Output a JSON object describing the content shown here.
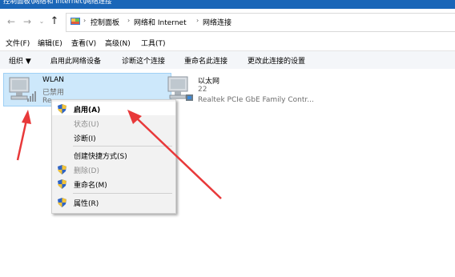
{
  "window": {
    "title": "控制面板\\网络和 Internet\\网络连接"
  },
  "address": {
    "crumbs": [
      "控制面板",
      "网络和 Internet",
      "网络连接"
    ]
  },
  "menu": {
    "items": [
      "文件(F)",
      "编辑(E)",
      "查看(V)",
      "高级(N)",
      "工具(T)"
    ]
  },
  "commands": {
    "items": [
      "组织 ▼",
      "启用此网络设备",
      "诊断这个连接",
      "重命名此连接",
      "更改此连接的设置"
    ]
  },
  "connections": [
    {
      "name": "WLAN",
      "status": "已禁用",
      "device": "Re"
    },
    {
      "name": "以太网",
      "status": "22",
      "device": "Realtek PCIe GbE Family Contr..."
    }
  ],
  "context_menu": {
    "items": [
      "启用(A)",
      "状态(U)",
      "诊断(I)",
      "创建快捷方式(S)",
      "删除(D)",
      "重命名(M)",
      "属性(R)"
    ]
  },
  "colors": {
    "titlebar": "#1a66b8",
    "selection": "#cde8fb",
    "arrow": "#e8393a"
  }
}
